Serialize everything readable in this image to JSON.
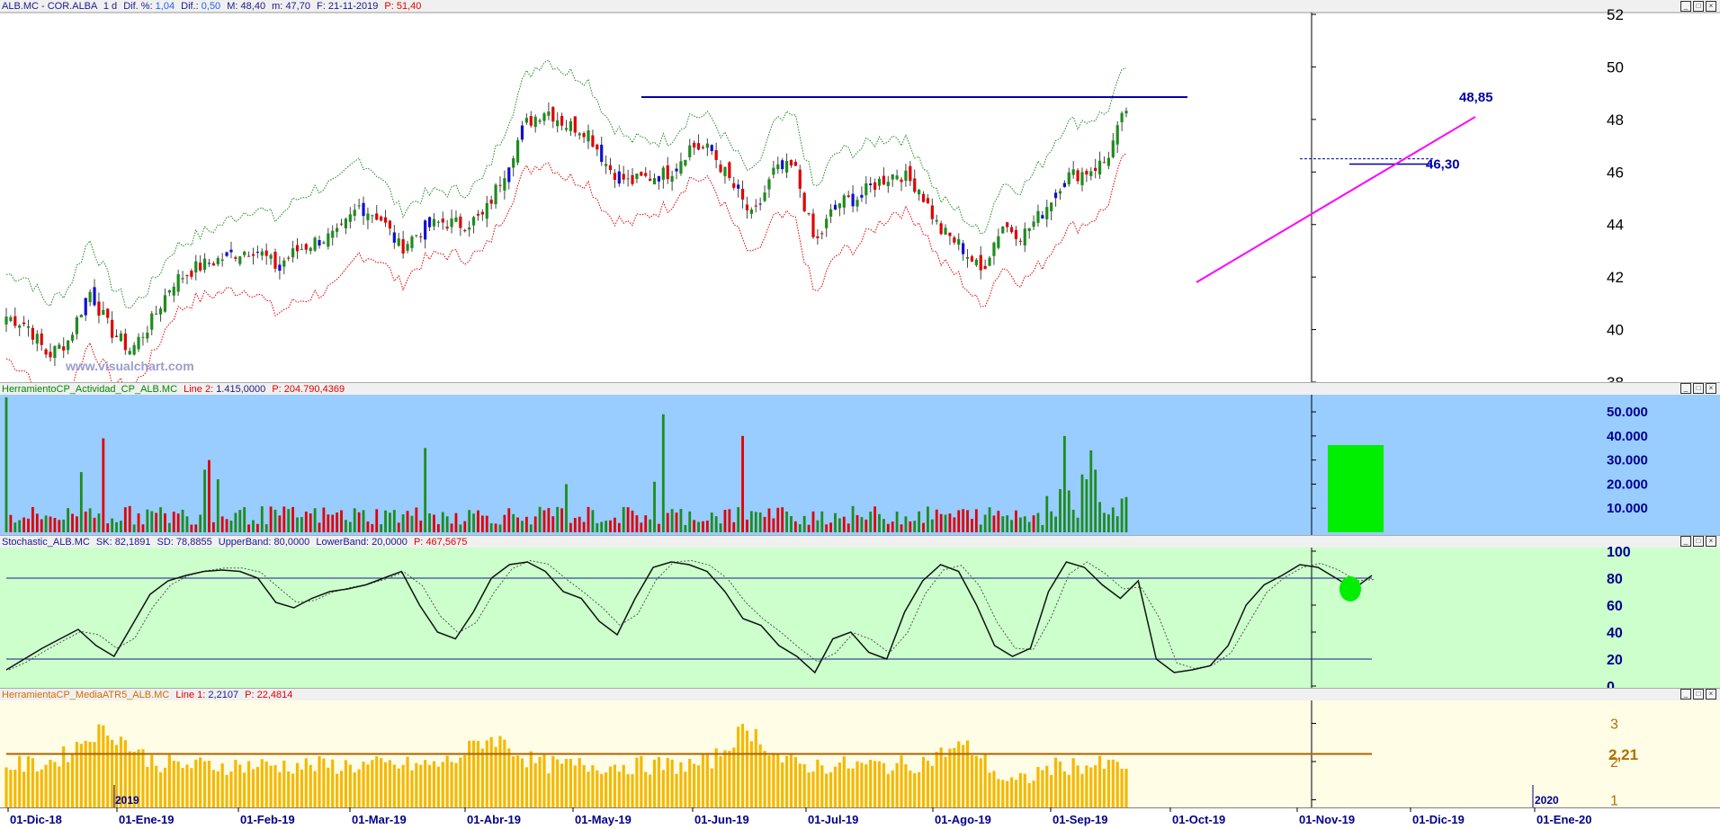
{
  "main_header": {
    "symbol": "ALB.MC - COR.ALBA",
    "period": "1 d",
    "dif_pct_label": "Dif. %:",
    "dif_pct": "1,04",
    "dif_label": "Dif.:",
    "dif": "0,50",
    "max_label": "M:",
    "max": "48,40",
    "min_label": "m:",
    "min": "47,70",
    "date_label": "F:",
    "date": "21-11-2019",
    "price_label": "P:",
    "price": "51,40"
  },
  "volume_header": {
    "name": "HerramientoCP_Actividad_CP_ALB.MC",
    "line_label": "Line 2:",
    "line_value": "1.415,0000",
    "p_label": "P:",
    "p_value": "204.790,4369"
  },
  "stoch_header": {
    "name": "Stochastic_ALB.MC",
    "sk_label": "SK:",
    "sk": "82,1891",
    "sd_label": "SD:",
    "sd": "78,8855",
    "upper_label": "UpperBand:",
    "upper": "80,0000",
    "lower_label": "LowerBand:",
    "lower": "20,0000",
    "p_label": "P:",
    "p_value": "467,5675"
  },
  "atr_header": {
    "name": "HerramientaCP_MediaATR5_ALB.MC",
    "line_label": "Line 1:",
    "line_value": "2,2107",
    "p_label": "P:",
    "p_value": "22,4814"
  },
  "watermark": "www.visualchart.com",
  "annotations": {
    "resistance_label": "48,85",
    "support_label": "46,30",
    "atr_last_label": "2,21",
    "year_2019": "2019",
    "year_2020": "2020"
  },
  "x_ticks": [
    "01-Dic-18",
    "01-Ene-19",
    "01-Feb-19",
    "01-Mar-19",
    "01-Abr-19",
    "01-May-19",
    "01-Jun-19",
    "01-Jul-19",
    "01-Ago-19",
    "01-Sep-19",
    "01-Oct-19",
    "01-Nov-19",
    "01-Dic-19",
    "01-Ene-20"
  ],
  "colors": {
    "up": "#1e8c1e",
    "down": "#e00000",
    "blue_candle": "#1010d0",
    "resistance": "#0000aa",
    "trendline": "#ff00ff",
    "vol_bg": "#99ccff",
    "stoch_bg": "#ccffcc",
    "atr_bg": "#fffde6",
    "atr_bar": "#f5b800",
    "highlight": "#00ee00"
  },
  "chart_data": [
    {
      "type": "candlestick",
      "yticks": [
        38,
        40,
        42,
        44,
        46,
        48,
        50,
        52
      ],
      "ylim": [
        38,
        52
      ],
      "channel_upper_color": "green",
      "channel_lower_color": "red",
      "closes": [
        40.5,
        40.2,
        39.0,
        39.6,
        41.5,
        40.0,
        39.2,
        40.3,
        41.8,
        42.3,
        42.6,
        42.9,
        43.1,
        42.4,
        43.0,
        43.4,
        43.6,
        44.7,
        44.3,
        43.1,
        43.8,
        44.1,
        44.0,
        44.3,
        46.0,
        47.8,
        48.4,
        47.8,
        47.6,
        46.2,
        45.6,
        45.8,
        46.0,
        47.0,
        46.8,
        45.5,
        44.2,
        46.0,
        46.2,
        43.2,
        44.8,
        45.0,
        45.6,
        46.0,
        45.4,
        43.8,
        43.2,
        42.2,
        44.0,
        43.6,
        44.5,
        45.8,
        46.0,
        46.4,
        48.4
      ],
      "notes": "approximate daily closes sampled across Dec-2018 to Nov-2019"
    },
    {
      "type": "bar",
      "name": "volume",
      "yticks": [
        "10.000",
        "20.000",
        "30.000",
        "40.000",
        "50.000"
      ],
      "ylim": [
        0,
        56000
      ]
    },
    {
      "type": "line",
      "name": "stochastic",
      "yticks": [
        0,
        20,
        40,
        60,
        80,
        100
      ],
      "ylim": [
        0,
        100
      ],
      "upper_band": 80,
      "lower_band": 20,
      "sk_points": [
        12,
        20,
        28,
        35,
        42,
        30,
        22,
        45,
        68,
        78,
        82,
        85,
        86,
        85,
        80,
        62,
        58,
        65,
        70,
        72,
        75,
        80,
        85,
        60,
        40,
        35,
        55,
        80,
        90,
        92,
        85,
        70,
        65,
        48,
        38,
        65,
        88,
        92,
        90,
        85,
        70,
        50,
        45,
        30,
        22,
        10,
        35,
        40,
        25,
        20,
        55,
        78,
        90,
        85,
        60,
        30,
        22,
        28,
        70,
        92,
        88,
        75,
        65,
        78,
        20,
        10,
        12,
        15,
        30,
        60,
        75,
        82,
        90,
        88,
        80,
        72,
        82
      ]
    },
    {
      "type": "bar",
      "name": "ATR5 average",
      "yticks": [
        1,
        2,
        3
      ],
      "ylim": [
        0.8,
        3.6
      ],
      "last_value": 2.21
    }
  ]
}
